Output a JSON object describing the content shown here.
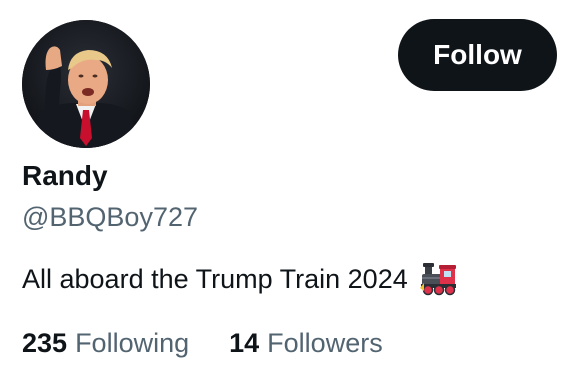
{
  "profile": {
    "display_name": "Randy",
    "handle": "@BBQBoy727",
    "bio_text": "All aboard the Trump Train 2024",
    "bio_emoji": "locomotive-emoji",
    "avatar": "avatar-photo"
  },
  "actions": {
    "follow_label": "Follow"
  },
  "stats": {
    "following_count": "235",
    "following_label": "Following",
    "followers_count": "14",
    "followers_label": "Followers"
  },
  "colors": {
    "text_primary": "#0f1419",
    "text_secondary": "#536471",
    "button_bg": "#0f1419",
    "button_text": "#ffffff",
    "background": "#ffffff"
  }
}
